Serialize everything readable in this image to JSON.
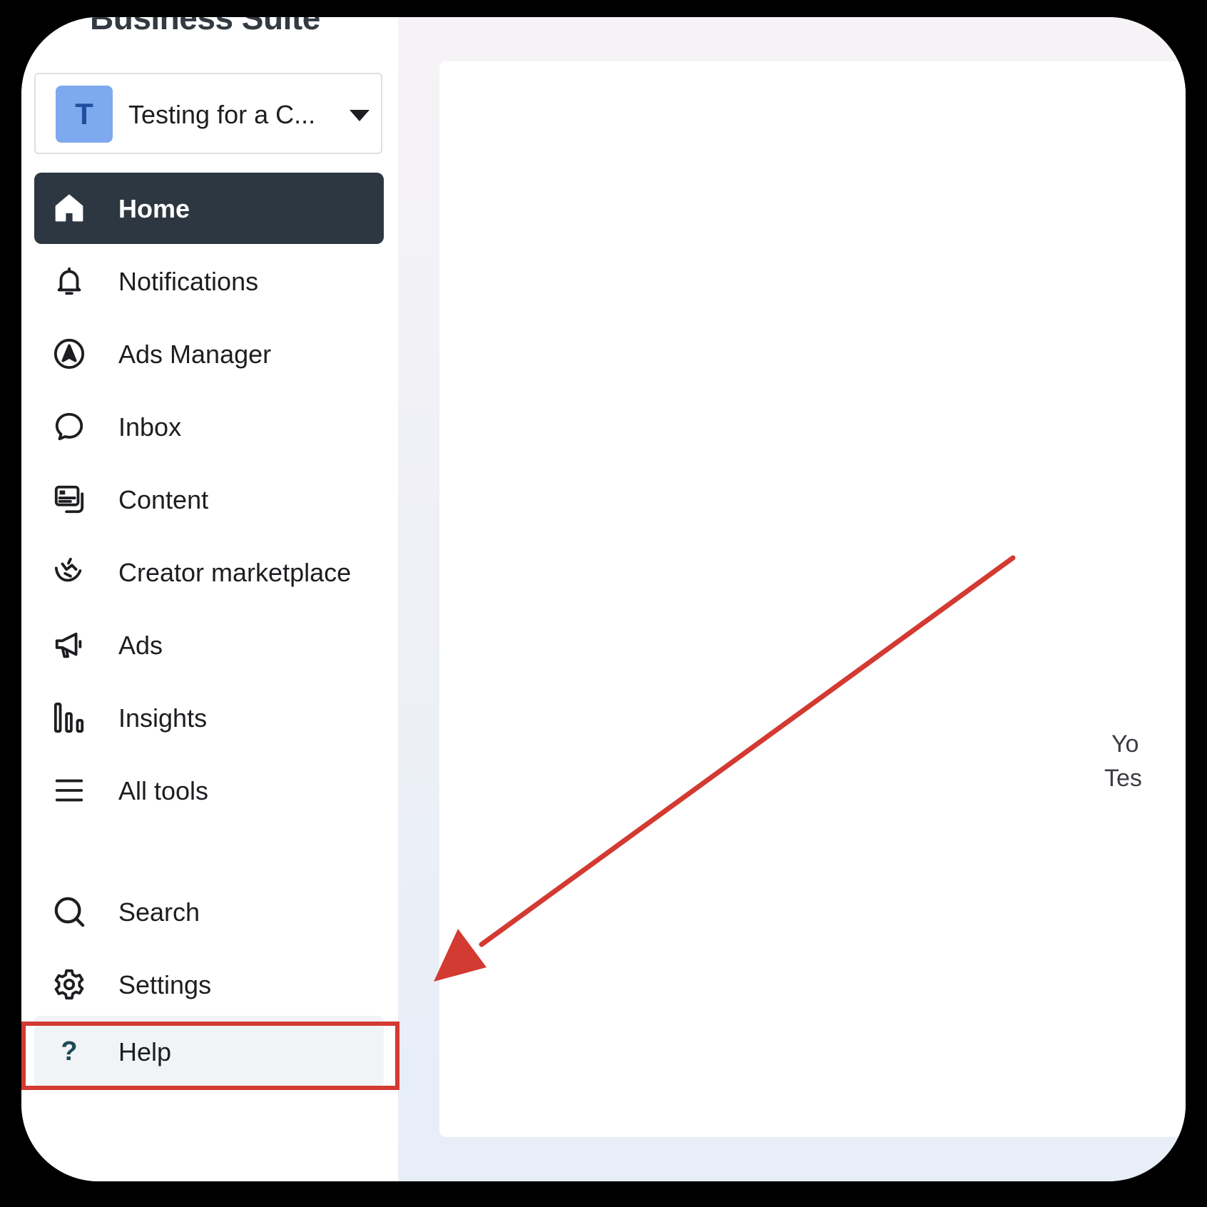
{
  "app": {
    "brand": "Business Suite"
  },
  "account": {
    "avatar_letter": "T",
    "name": "Testing for a C..."
  },
  "nav": {
    "home": "Home",
    "notifications": "Notifications",
    "ads_manager": "Ads Manager",
    "inbox": "Inbox",
    "content": "Content",
    "creator_marketplace": "Creator marketplace",
    "ads": "Ads",
    "insights": "Insights",
    "all_tools": "All tools",
    "search": "Search",
    "settings": "Settings",
    "help": "Help",
    "help_glyph": "?"
  },
  "main": {
    "clipped_line_1": "Yo",
    "clipped_line_2": "Tes"
  },
  "colors": {
    "active_bg": "#2d3741",
    "avatar_bg": "#7fa9ee",
    "annotation_red": "#d33a31"
  }
}
